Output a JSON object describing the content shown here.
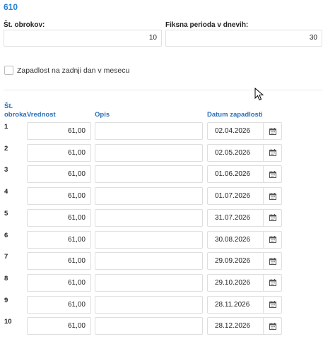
{
  "title": "610",
  "fields": {
    "installments": {
      "label": "Št. obrokov:",
      "value": "10"
    },
    "period": {
      "label": "Fiksna perioda v dnevih:",
      "value": "30"
    }
  },
  "checkbox": {
    "label": "Zapadlost na zadnji dan v mesecu",
    "checked": false
  },
  "table": {
    "headers": {
      "num_line1": "Št.",
      "num_line2": "obroka",
      "value": "Vrednost",
      "desc": "Opis",
      "date": "Datum zapadlosti"
    },
    "rows": [
      {
        "num": "1",
        "value": "61,00",
        "desc": "",
        "date": "02.04.2026"
      },
      {
        "num": "2",
        "value": "61,00",
        "desc": "",
        "date": "02.05.2026"
      },
      {
        "num": "3",
        "value": "61,00",
        "desc": "",
        "date": "01.06.2026"
      },
      {
        "num": "4",
        "value": "61,00",
        "desc": "",
        "date": "01.07.2026"
      },
      {
        "num": "5",
        "value": "61,00",
        "desc": "",
        "date": "31.07.2026"
      },
      {
        "num": "6",
        "value": "61,00",
        "desc": "",
        "date": "30.08.2026"
      },
      {
        "num": "7",
        "value": "61,00",
        "desc": "",
        "date": "29.09.2026"
      },
      {
        "num": "8",
        "value": "61,00",
        "desc": "",
        "date": "29.10.2026"
      },
      {
        "num": "9",
        "value": "61,00",
        "desc": "",
        "date": "28.11.2026"
      },
      {
        "num": "10",
        "value": "61,00",
        "desc": "",
        "date": "28.12.2026"
      }
    ]
  },
  "icons": {
    "date_picker": "calendar-icon",
    "pointer": "mouse-cursor-icon"
  },
  "colors": {
    "title": "#2a7fd4",
    "header": "#2a6fba"
  }
}
